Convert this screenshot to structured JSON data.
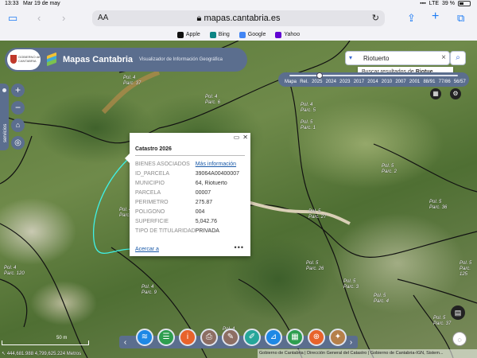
{
  "status": {
    "time": "13:33",
    "date": "Mar 19 de may",
    "network": "LTE",
    "battery": "39 %",
    "battery_level": 0.39
  },
  "browser": {
    "text_size": "AA",
    "url": "mapas.cantabria.es",
    "bookmarks": [
      {
        "label": "Apple",
        "icon": "apple-icon",
        "color": "#111111"
      },
      {
        "label": "Bing",
        "icon": "bing-icon",
        "color": "#0c8484"
      },
      {
        "label": "Google",
        "icon": "google-icon",
        "color": "#4285f4"
      },
      {
        "label": "Yahoo",
        "icon": "yahoo-icon",
        "color": "#6001d2"
      }
    ]
  },
  "app": {
    "logo_text": "GOBIERNO de CANTABRIA",
    "title": "Mapas Cantabria",
    "subtitle": "Visualizador de Información Geográfica",
    "services_label": "servicios",
    "brand_color": "#5b6e8e"
  },
  "search": {
    "value": "Riotuerto",
    "suggestion_prefix": "Buscar resultados de ",
    "suggestion_term": "Riotue..."
  },
  "timeline": {
    "labels": [
      "Mapa",
      "Rel.",
      "2025",
      "2024",
      "2023",
      "2017",
      "2014",
      "2010",
      "2007",
      "2001",
      "88/91",
      "77/86",
      "56/57"
    ],
    "selected": "2025"
  },
  "popup": {
    "title": "Catastro 2026",
    "rows": [
      {
        "key": "BIENES ASOCIADOS",
        "value": "Más información",
        "link": true
      },
      {
        "key": "ID_PARCELA",
        "value": "39064A00400007"
      },
      {
        "key": "MUNICIPIO",
        "value": "64, Riotuerto"
      },
      {
        "key": "PARCELA",
        "value": "00007"
      },
      {
        "key": "PERIMETRO",
        "value": "275.87"
      },
      {
        "key": "POLIGONO",
        "value": "004"
      },
      {
        "key": "SUPERFICIE",
        "value": "5,042.76"
      },
      {
        "key": "TIPO DE TITULARIDAD",
        "value": "PRIVADA"
      }
    ],
    "zoom_link": "Acercar a",
    "more": "•••"
  },
  "parcels": [
    {
      "pol": "Pol. 4",
      "parc": "Parc. 37"
    },
    {
      "pol": "Pol. 4",
      "parc": "Parc. 6"
    },
    {
      "pol": "Pol. 4",
      "parc": "Parc. 5"
    },
    {
      "pol": "Pol. 5",
      "parc": "Parc. 1"
    },
    {
      "pol": "Pol. 5",
      "parc": "Parc. 2"
    },
    {
      "pol": "Pol. 4",
      "parc": "Parc. 3"
    },
    {
      "pol": "Pol. 5",
      "parc": "Parc. 36"
    },
    {
      "pol": "Pol. 5",
      "parc": "Parc. 27"
    },
    {
      "pol": "Pol. 5",
      "parc": "Parc. 26"
    },
    {
      "pol": "Pol. 5",
      "parc": "Parc. 3"
    },
    {
      "pol": "Pol. 5",
      "parc": "Parc. 4"
    },
    {
      "pol": "Pol. 4",
      "parc": "Parc. 9"
    },
    {
      "pol": "Pol. 4",
      "parc": "Parc. 120"
    },
    {
      "pol": "Pol. 5",
      "parc": "Parc. 125"
    },
    {
      "pol": "Pol. 5",
      "parc": "Parc. 37"
    },
    {
      "pol": "Pol. 4",
      "parc": "Parc. 8"
    },
    {
      "pol": "Pol. 4",
      "parc": "Parc."
    }
  ],
  "tools": [
    {
      "name": "layers-tool",
      "icon": "layers-icon",
      "glyph": "≋",
      "color": "#1e88e5"
    },
    {
      "name": "legend-tool",
      "icon": "list-icon",
      "glyph": "☰",
      "color": "#2e9e4f"
    },
    {
      "name": "info-tool",
      "icon": "info-icon",
      "glyph": "i",
      "color": "#e8632b"
    },
    {
      "name": "print-tool",
      "icon": "printer-icon",
      "glyph": "⎙",
      "color": "#8d6e63"
    },
    {
      "name": "report-tool",
      "icon": "document-icon",
      "glyph": "✎",
      "color": "#8d6e63"
    },
    {
      "name": "draw-tool",
      "icon": "pencil-icon",
      "glyph": "✐",
      "color": "#26a69a"
    },
    {
      "name": "measure-tool",
      "icon": "ruler-icon",
      "glyph": "⊿",
      "color": "#1e88e5"
    },
    {
      "name": "grid-tool",
      "icon": "grid-icon",
      "glyph": "▦",
      "color": "#2e9e4f"
    },
    {
      "name": "locate-tool",
      "icon": "crosshair-icon",
      "glyph": "⊕",
      "color": "#e8632b"
    },
    {
      "name": "compass-tool",
      "icon": "compass-icon",
      "glyph": "✦",
      "color": "#b5804a"
    }
  ],
  "map": {
    "scale_label": "50 m",
    "coordinates": "444,681.988 4,799,625.224 Metros",
    "attribution": "Gobierno de Cantabria | Dirección General del Catastro | Gobierno de Cantabria-IGN, Sistem..."
  }
}
